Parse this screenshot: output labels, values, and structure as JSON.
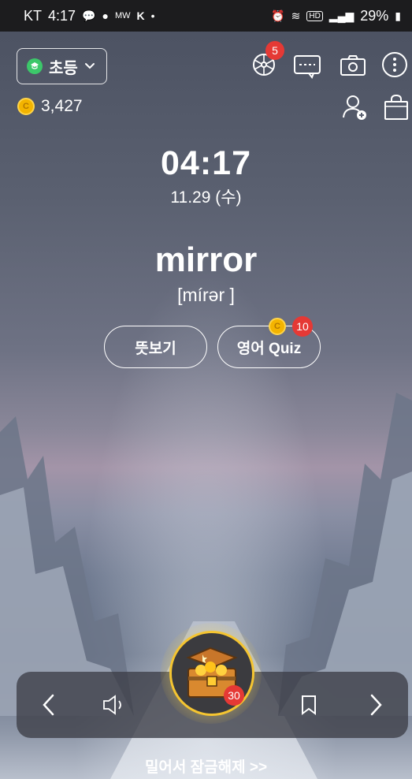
{
  "status_bar": {
    "carrier": "KT",
    "time": "4:17",
    "hd": "HD",
    "battery": "29%"
  },
  "header": {
    "grade_label": "초등",
    "coin_count": "3,427",
    "notification_count": "5"
  },
  "lock": {
    "time": "04:17",
    "date": "11.29 (수)",
    "word": "mirror",
    "pronunciation": "[mírər ]",
    "meaning_button": "뜻보기",
    "quiz_button": "영어 Quiz",
    "quiz_badge": "10"
  },
  "bottom": {
    "chest_badge": "30",
    "unlock_text": "밀어서 잠금해제 >>"
  },
  "colors": {
    "badge_red": "#e53935",
    "coin_gold": "#f4b400",
    "grade_green": "#3cc76a",
    "chest_ring": "#f5c531"
  }
}
